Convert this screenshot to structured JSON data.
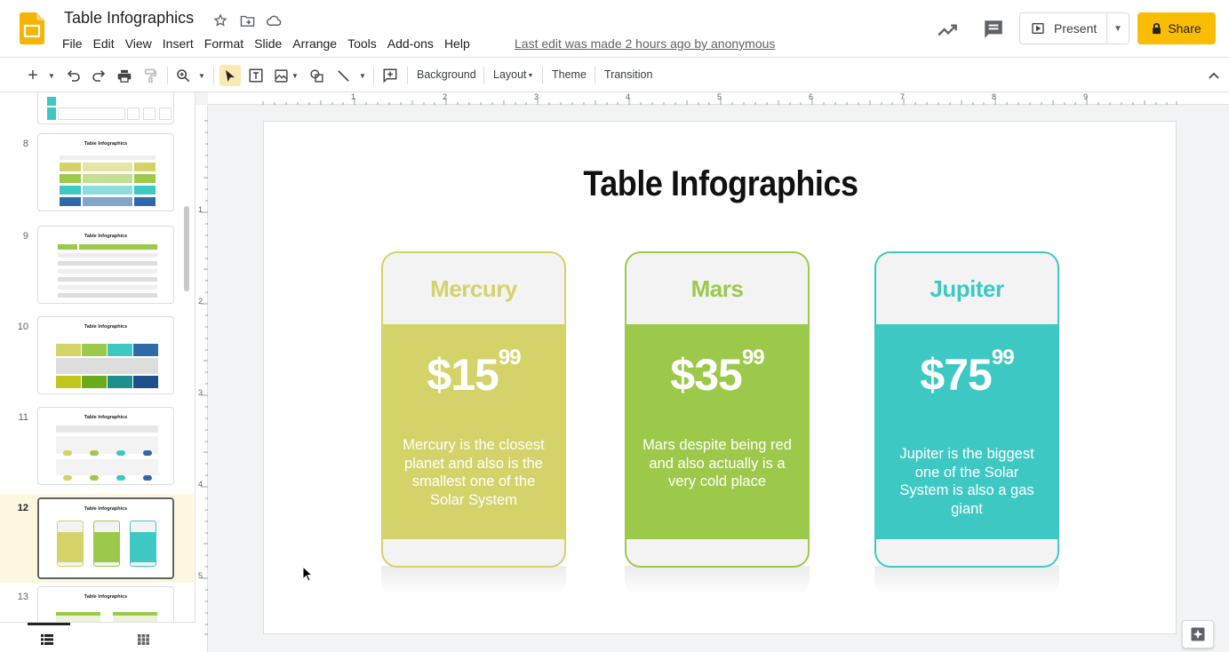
{
  "app": {
    "doc_title": "Table Infographics",
    "last_edit": "Last edit was made 2 hours ago by anonymous",
    "menu": [
      "File",
      "Edit",
      "View",
      "Insert",
      "Format",
      "Slide",
      "Arrange",
      "Tools",
      "Add-ons",
      "Help"
    ],
    "present_label": "Present",
    "share_label": "Share"
  },
  "toolbar": {
    "background_label": "Background",
    "layout_label": "Layout",
    "theme_label": "Theme",
    "transition_label": "Transition"
  },
  "ruler": {
    "top": [
      "1",
      "2",
      "3",
      "4",
      "5",
      "6",
      "7",
      "8",
      "9"
    ],
    "left": [
      "1",
      "2",
      "3",
      "4",
      "5"
    ]
  },
  "filmstrip": {
    "slides": [
      {
        "number": "8",
        "title": "Table Infographics"
      },
      {
        "number": "9",
        "title": "Table Infographics"
      },
      {
        "number": "10",
        "title": "Table Infographics"
      },
      {
        "number": "11",
        "title": "Table Infographics"
      },
      {
        "number": "12",
        "title": "Table Infographics"
      },
      {
        "number": "13",
        "title": "Table Infographics"
      }
    ],
    "active_slide": "12"
  },
  "slide": {
    "title": "Table Infographics",
    "cards": [
      {
        "name": "Mercury",
        "price_main": "$15",
        "price_cents": "99",
        "description": "Mercury is the closest planet and also is the smallest one of the Solar System",
        "color": "#d3d36a"
      },
      {
        "name": "Mars",
        "price_main": "$35",
        "price_cents": "99",
        "description": "Mars despite being red and also actually is a very cold place",
        "color": "#9cc94a"
      },
      {
        "name": "Jupiter",
        "price_main": "$75",
        "price_cents": "99",
        "description": "Jupiter is the biggest one of the Solar System is also a gas giant",
        "color": "#3ec8c4"
      }
    ]
  },
  "colors": {
    "share": "#fbbc04",
    "active_slide_bg": "#fef7e0"
  }
}
